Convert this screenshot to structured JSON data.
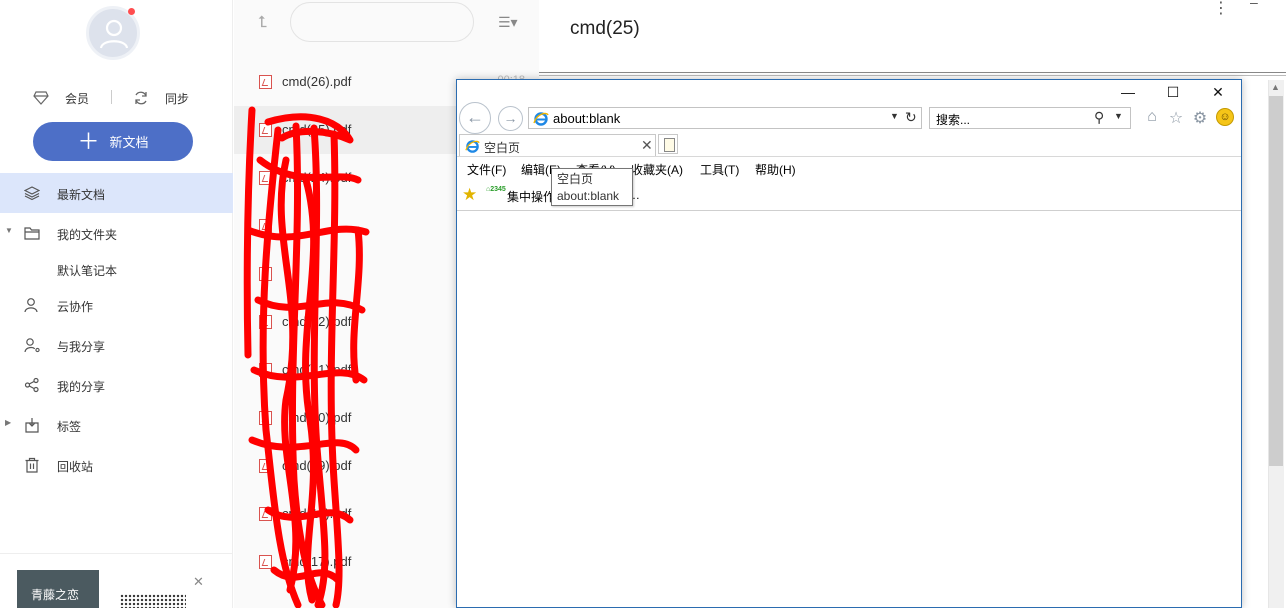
{
  "sidebar": {
    "quick": {
      "vip_label": "会员",
      "sync_label": "同步"
    },
    "new_doc_label": "新文档",
    "nav": [
      {
        "label": "最新文档"
      },
      {
        "label": "我的文件夹"
      },
      {
        "label": "默认笔记本"
      },
      {
        "label": "云协作"
      },
      {
        "label": "与我分享"
      },
      {
        "label": "我的分享"
      },
      {
        "label": "标签"
      },
      {
        "label": "回收站"
      }
    ],
    "ad": {
      "title": "青藤之恋"
    }
  },
  "filelist": {
    "files": [
      {
        "name": "cmd(26).pdf",
        "time": "00:18"
      },
      {
        "name": "cmd(25).pdf"
      },
      {
        "name": "cmd(24).pdf"
      },
      {
        "name": ""
      },
      {
        "name": ""
      },
      {
        "name": "cmd(22).pdf"
      },
      {
        "name": "cmd(21).pdf"
      },
      {
        "name": "cmd(20).pdf"
      },
      {
        "name": "cmd(19).pdf"
      },
      {
        "name": "cmd(18).pdf"
      },
      {
        "name": "cmd(17).pdf"
      }
    ]
  },
  "doc": {
    "title": "cmd(25)",
    "more": "⋮",
    "minimize": "–"
  },
  "ie": {
    "controls": {
      "minimize": "—",
      "maximize": "☐",
      "close": "✕"
    },
    "address": "about:blank",
    "search_placeholder": "搜索...",
    "tab_title": "空白页",
    "menu": [
      {
        "label": "文件(F)"
      },
      {
        "label": "编辑(E)"
      },
      {
        "label": "查看(V)"
      },
      {
        "label": "收藏夹(A)"
      },
      {
        "label": "工具(T)"
      },
      {
        "label": "帮助(H)"
      }
    ],
    "fav_label": "集中操作",
    "fav_tail": "…",
    "tooltip": {
      "title": "空白页",
      "url": "about:blank"
    }
  },
  "colors": {
    "accent": "#4d6fc7",
    "active_nav_bg": "#dce6fb",
    "pdf_red": "#d9534f",
    "scribble": "#ff0000"
  },
  "icons": [
    "user-avatar-icon",
    "diamond-icon",
    "sync-icon",
    "plus-icon",
    "layers-icon",
    "folder-icon",
    "person-icon",
    "share-with-me-icon",
    "share-icon",
    "tag-icon",
    "trash-icon",
    "pdf-icon",
    "ie-icon",
    "home-icon",
    "star-icon",
    "gear-icon",
    "smiley-icon"
  ]
}
